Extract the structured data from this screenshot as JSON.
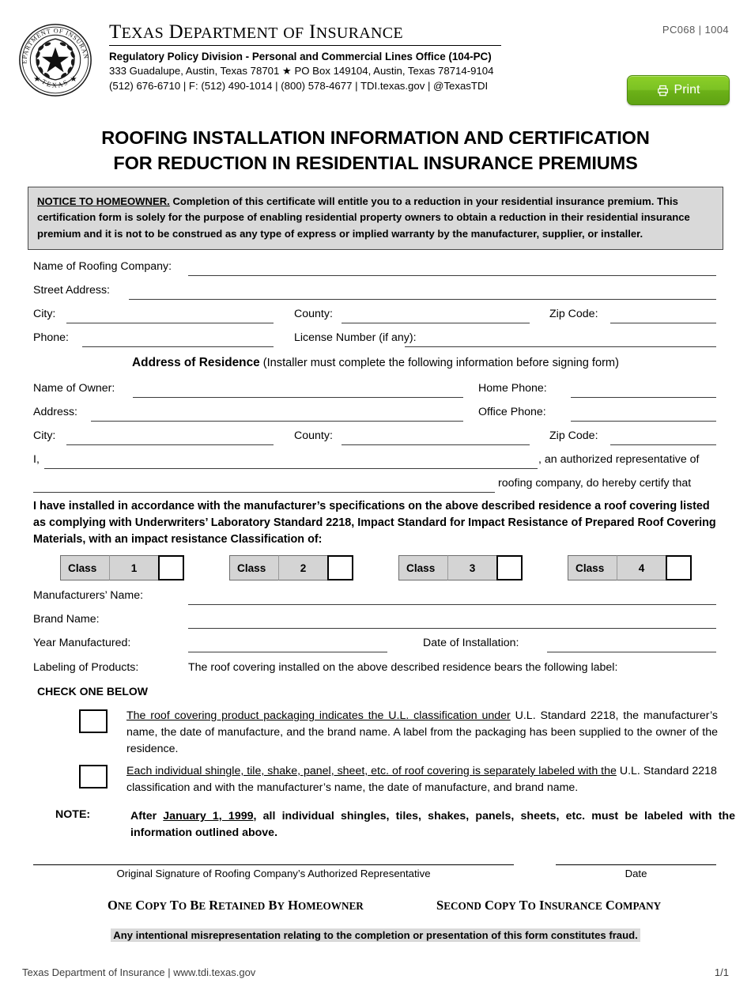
{
  "header": {
    "org_name": "Texas Department of Insurance",
    "division": "Regulatory Policy Division - Personal and Commercial Lines Office (104-PC)",
    "address_line": "333 Guadalupe, Austin, Texas 78701 ★ PO Box 149104, Austin, Texas 78714-9104",
    "contact_line": "(512) 676-6710 | F: (512) 490-1014 | (800) 578-4677 | TDI.texas.gov | @TexasTDI",
    "form_code": "PC068 | 1004",
    "print_label": "Print",
    "seal_outer_top": "DEPARTMENT OF INSURANCE",
    "seal_outer_bottom": "TEXAS"
  },
  "title": {
    "line1": "ROOFING INSTALLATION INFORMATION AND CERTIFICATION",
    "line2": "FOR REDUCTION IN RESIDENTIAL INSURANCE PREMIUMS"
  },
  "notice": {
    "heading": "NOTICE TO HOMEOWNER.",
    "body": "Completion of this certificate will entitle you to a reduction in your residential insurance premium.  This certification form is solely for the purpose of enabling residential property owners to obtain a reduction in their residential insurance premium and it is not to be construed as any type of express or implied warranty by the manufacturer, supplier, or installer."
  },
  "company": {
    "name_label": "Name of Roofing Company:",
    "name_value": "",
    "street_label": "Street Address:",
    "street_value": "",
    "city_label": "City:",
    "city_value": "",
    "county_label": "County:",
    "county_value": "",
    "zip_label": "Zip Code:",
    "zip_value": "",
    "phone_label": "Phone:",
    "phone_value": "",
    "license_label": "License Number (if any):",
    "license_value": ""
  },
  "residence": {
    "section_title": "Address of Residence",
    "section_subtitle": "(Installer must complete the following information before signing form)",
    "owner_label": "Name of Owner:",
    "owner_value": "",
    "home_phone_label": "Home Phone:",
    "home_phone_value": "",
    "address_label": "Address:",
    "address_value": "",
    "office_phone_label": "Office Phone:",
    "office_phone_value": "",
    "city_label": "City:",
    "city_value": "",
    "county_label": "County:",
    "county_value": "",
    "zip_label": "Zip Code:",
    "zip_value": ""
  },
  "certify": {
    "i_label": "I,",
    "rep_name_value": "",
    "after_name": ", an authorized representative of",
    "company_name_value": "",
    "after_company": "roofing company, do hereby certify that",
    "statement": "I have installed in accordance with the manufacturer’s specifications on the above described residence a roof covering listed as complying with Underwriters’ Laboratory Standard 2218, Impact Standard for Impact Resistance of Prepared Roof Covering Materials, with an impact resistance Classification of:"
  },
  "classes": [
    {
      "label": "Class",
      "number": "1",
      "checked": false
    },
    {
      "label": "Class",
      "number": "2",
      "checked": false
    },
    {
      "label": "Class",
      "number": "3",
      "checked": false
    },
    {
      "label": "Class",
      "number": "4",
      "checked": false
    }
  ],
  "product": {
    "manufacturers_label": "Manufacturers’ Name:",
    "manufacturers_value": "",
    "brand_label": "Brand Name:",
    "brand_value": "",
    "year_label": "Year Manufactured:",
    "year_value": "",
    "install_date_label": "Date of Installation:",
    "install_date_value": "",
    "labeling_label": "Labeling of Products:",
    "labeling_text": "The roof covering installed on the above described residence bears the following label:"
  },
  "check_one": {
    "heading": "CHECK ONE BELOW",
    "option1_underlined": "The roof covering product packaging indicates the U.L. classification under",
    "option1_rest": " U.L. Standard 2218, the manufacturer’s name, the date of manufacture, and the brand name.  A label from the packaging has been supplied to the owner of the residence.",
    "option1_checked": false,
    "option2_underlined": "Each individual shingle, tile, shake, panel, sheet, etc. of roof covering is separately labeled with the",
    "option2_rest": " U.L. Standard 2218 classification and with the manufacturer’s name, the date of manufacture, and brand name.",
    "option2_checked": false
  },
  "note": {
    "label": "NOTE:",
    "before": "After ",
    "underlined": "January 1, 1999",
    "after": ", all individual shingles, tiles, shakes, panels, sheets, etc. must be labeled with the information outlined above."
  },
  "signature": {
    "signature_caption": "Original Signature of Roofing Company’s Authorized Representative",
    "date_caption": "Date",
    "signature_value": "",
    "date_value": ""
  },
  "copies": {
    "left": "One Copy To Be Retained By Homeowner",
    "right": "Second Copy To Insurance Company"
  },
  "fraud_notice": "Any intentional misrepresentation relating to the completion or presentation of this form constitutes fraud.",
  "footer": {
    "left": "Texas Department of Insurance | www.tdi.texas.gov",
    "right": "1/1"
  },
  "colors": {
    "print_button_green": "#7cc224",
    "notice_background": "#d9d9d9",
    "class_box_background": "#d4d4d4",
    "rule": "#3b3b3b"
  }
}
